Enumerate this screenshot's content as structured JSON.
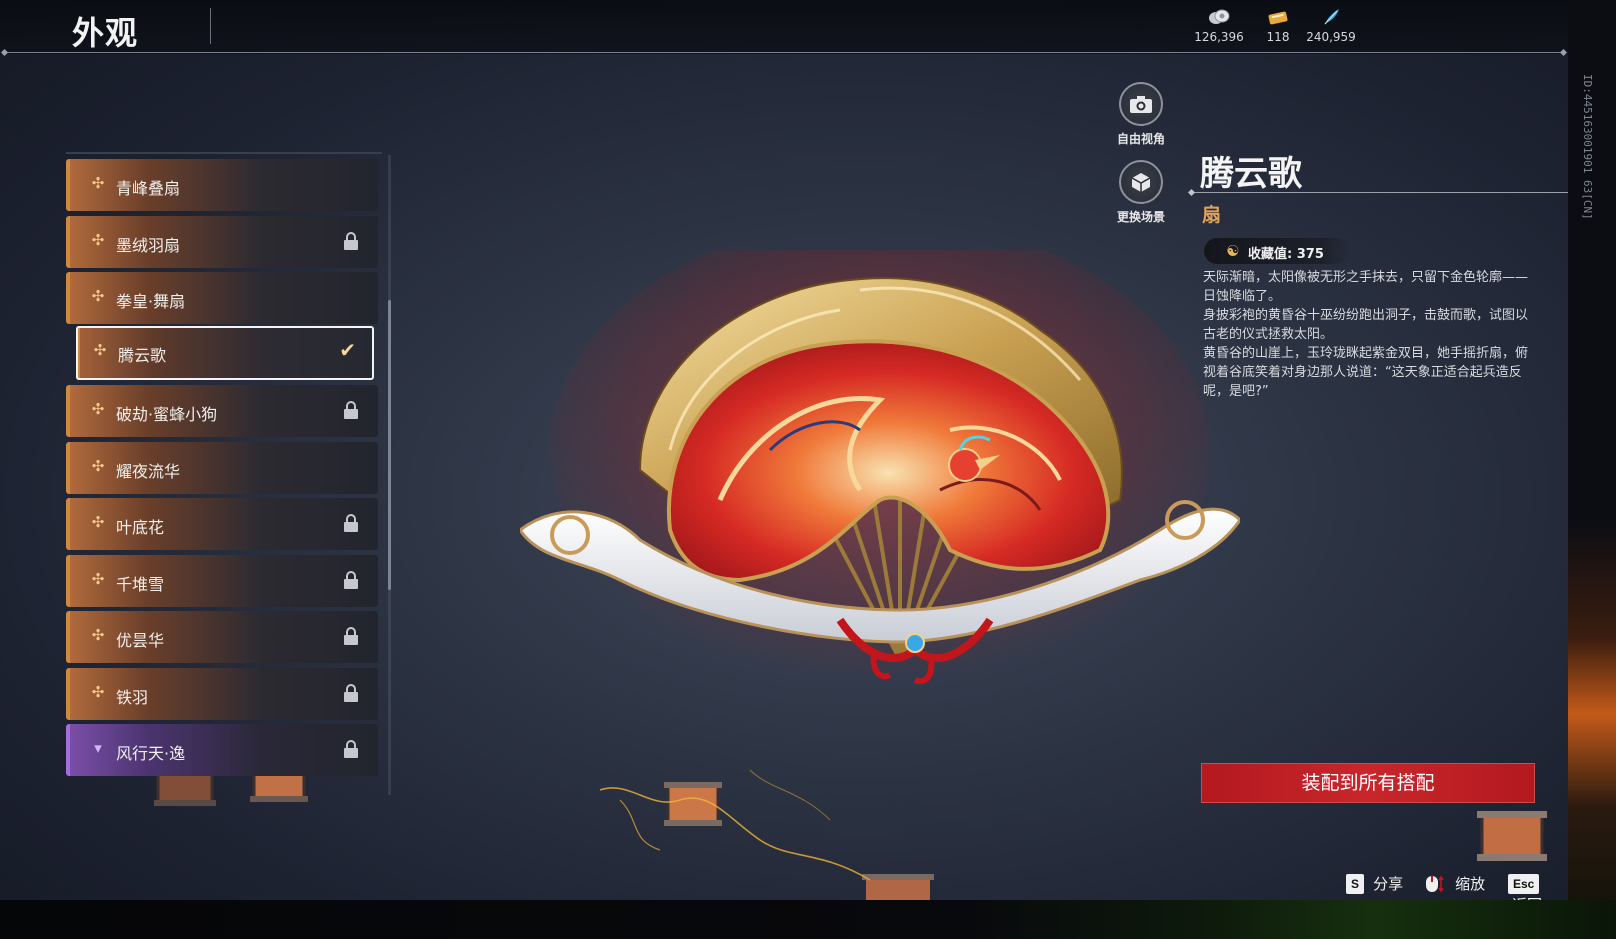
{
  "header": {
    "title": "外观",
    "currencies": [
      {
        "icon": "silver-coin-icon",
        "value": "126,396"
      },
      {
        "icon": "gold-ticket-icon",
        "value": "118"
      },
      {
        "icon": "blue-feather-icon",
        "value": "240,959"
      }
    ]
  },
  "side_id": "ID:445163001901 63[CN]",
  "view_buttons": {
    "free_view": "自由视角",
    "change_scene": "更换场景"
  },
  "items": [
    {
      "label": "青峰叠扇",
      "locked": false,
      "rarity": "orange"
    },
    {
      "label": "墨绒羽扇",
      "locked": true,
      "rarity": "orange"
    },
    {
      "label": "拳皇·舞扇",
      "locked": false,
      "rarity": "orange"
    },
    {
      "label": "腾云歌",
      "locked": false,
      "rarity": "orange",
      "selected": true
    },
    {
      "label": "破劫·蜜蜂小狗",
      "locked": true,
      "rarity": "orange"
    },
    {
      "label": "耀夜流华",
      "locked": false,
      "rarity": "orange"
    },
    {
      "label": "叶底花",
      "locked": true,
      "rarity": "orange"
    },
    {
      "label": "千堆雪",
      "locked": true,
      "rarity": "orange"
    },
    {
      "label": "优昙华",
      "locked": true,
      "rarity": "orange"
    },
    {
      "label": "铁羽",
      "locked": true,
      "rarity": "orange"
    },
    {
      "label": "风行天·逸",
      "locked": true,
      "rarity": "purple"
    }
  ],
  "detail": {
    "name": "腾云歌",
    "type": "扇",
    "collect_label": "收藏值: 375",
    "description": [
      "天际渐暗，太阳像被无形之手抹去，只留下金色轮廓——日蚀降临了。",
      "身披彩袍的黄昏谷十巫纷纷跑出洞子，击鼓而歌，试图以古老的仪式拯救太阳。",
      "黄昏谷的山崖上，玉玲珑眯起紫金双目，她手摇折扇，俯视着谷底笑着对身边那人说道：“这天象正适合起兵造反呢，是吧?”"
    ],
    "equip_button": "装配到所有搭配"
  },
  "hotkeys": [
    {
      "key": "S",
      "label": "分享"
    },
    {
      "key": "",
      "label": "缩放",
      "icon": "mouse-icon"
    },
    {
      "key": "Esc",
      "label": "返回"
    }
  ],
  "colors": {
    "accent_orange": "#d08a3c",
    "accent_purple": "#a56de0",
    "equip_red": "#c8262b",
    "type_gold": "#e3a25a"
  }
}
